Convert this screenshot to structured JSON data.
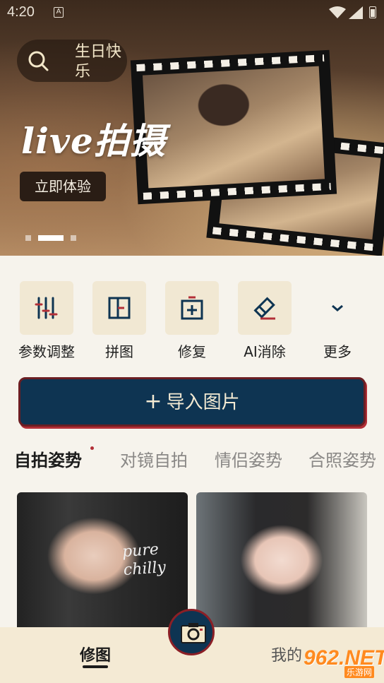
{
  "status_bar": {
    "time": "4:20",
    "indicator": "A"
  },
  "banner": {
    "search_text": "生日快乐",
    "title": "live拍摄",
    "cta_label": "立即体验",
    "dots": 3,
    "active_dot": 2
  },
  "tools": [
    {
      "label": "参数调整",
      "icon": "sliders-icon"
    },
    {
      "label": "拼图",
      "icon": "collage-icon"
    },
    {
      "label": "修复",
      "icon": "repair-icon"
    },
    {
      "label": "AI消除",
      "icon": "eraser-icon"
    },
    {
      "label": "更多",
      "icon": "chevron-down-icon"
    }
  ],
  "import_button": {
    "plus": "+",
    "label": "导入图片"
  },
  "tabs": [
    {
      "label": "自拍姿势",
      "active": true
    },
    {
      "label": "对镜自拍",
      "active": false
    },
    {
      "label": "情侣姿势",
      "active": false
    },
    {
      "label": "合照姿势",
      "active": false
    }
  ],
  "cards": [
    {
      "caption": "pure\nchilly"
    },
    {
      "caption": ""
    }
  ],
  "bottom_nav": {
    "edit_label": "修图",
    "mine_label": "我的"
  },
  "watermark": {
    "main": "962.NET",
    "sub": "乐游网"
  },
  "colors": {
    "navy": "#0e3452",
    "accent_red": "#b22f37",
    "tool_bg": "#f1e8d3",
    "page_bg": "#f6f3ec"
  }
}
